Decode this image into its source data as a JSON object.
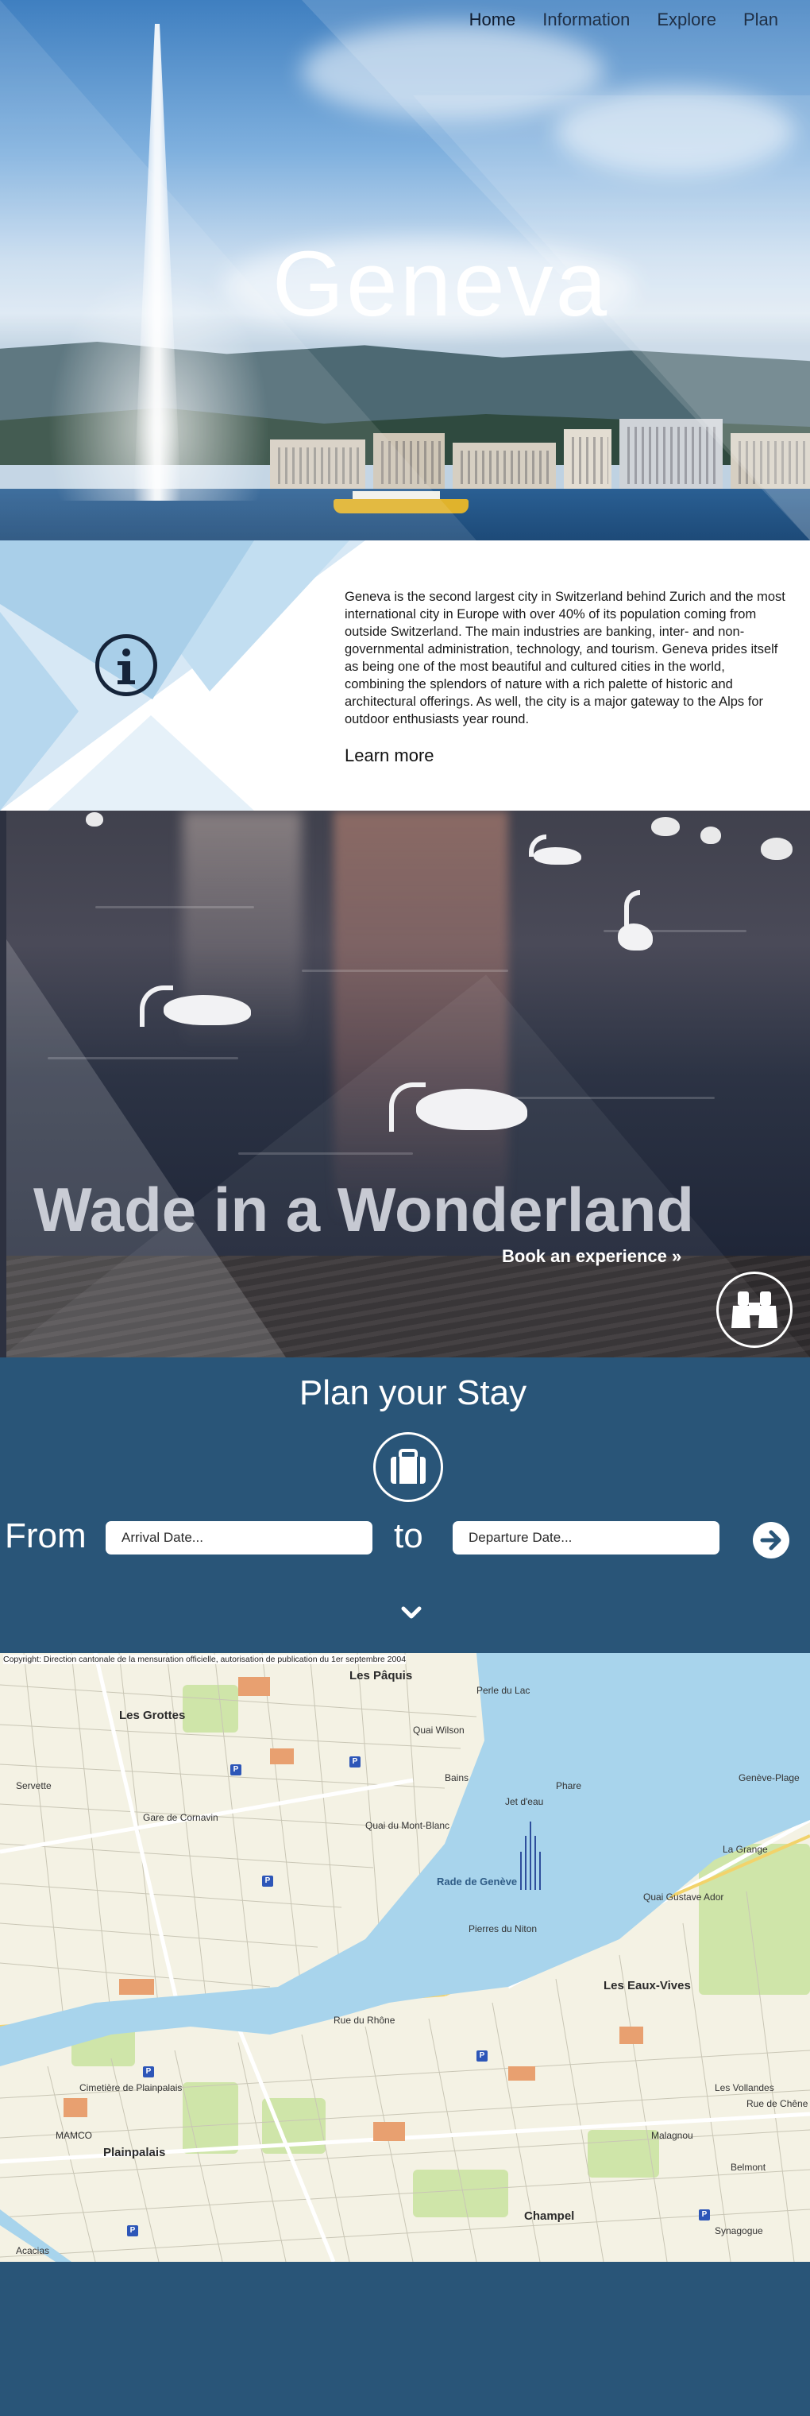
{
  "nav": {
    "items": [
      {
        "label": "Home",
        "active": true
      },
      {
        "label": "Information",
        "active": false
      },
      {
        "label": "Explore",
        "active": false
      },
      {
        "label": "Plan",
        "active": false
      }
    ]
  },
  "hero": {
    "title": "Geneva"
  },
  "info": {
    "icon": "info-icon",
    "paragraph": "Geneva is the second largest city in Switzerland behind Zurich and the most international city in Europe with over 40% of its population coming from outside Switzerland. The main industries are banking, inter- and non-governmental administration, technology, and tourism. Geneva prides itself as being one of the most beautiful and cultured cities in the world, combining the splendors of nature with a rich palette of historic and architectural offerings. As well, the city is a major gateway to the Alps for outdoor enthusiasts year round.",
    "learn_more": "Learn more"
  },
  "feature": {
    "title": "Wade in a Wonderland",
    "book_link": "Book an experience »",
    "icon": "binoculars-icon"
  },
  "plan": {
    "title": "Plan your Stay",
    "icon": "suitcase-icon",
    "from_label": "From",
    "to_label": "to",
    "arrival_placeholder": "Arrival Date...",
    "departure_placeholder": "Departure Date...",
    "submit_icon": "arrow-right-icon",
    "expand_icon": "chevron-down-icon"
  },
  "map": {
    "copyright": "Copyright: Direction cantonale de la mensuration officielle, autorisation de publication du 1er septembre 2004",
    "labels": {
      "les_grottes": "Les Grottes",
      "les_paquis": "Les Pâquis",
      "rade": "Rade de Genève",
      "plainpalais": "Plainpalais",
      "jet_deau": "Jet d'eau",
      "geneve_plage": "Genève-Plage",
      "cornavin": "Gare de Cornavin",
      "pierres_niton": "Pierres du Niton",
      "la_grange": "La Grange",
      "les_eaux_vives": "Les Eaux-Vives",
      "champel": "Champel",
      "malagnou": "Malagnou",
      "belmont": "Belmont",
      "rue_rhone": "Rue du Rhône",
      "quai_mont_blanc": "Quai du Mont-Blanc",
      "quai_wilson": "Quai Wilson",
      "quai_gustave_ador": "Quai Gustave Ador",
      "servette": "Servette",
      "vollandes": "Les Vollandes",
      "synagogue": "Synagogue",
      "acacias": "Acacias",
      "cimetiere": "Cimetière de Plainpalais",
      "mamco": "MAMCO",
      "la_perle": "Perle du Lac",
      "bains": "Bains",
      "phare": "Phare",
      "bout_monde": "Rue de Chêne"
    }
  },
  "colors": {
    "plan_bg": "#295578",
    "info_accent": "#a9cfe9",
    "icon_dark": "#15243a"
  }
}
